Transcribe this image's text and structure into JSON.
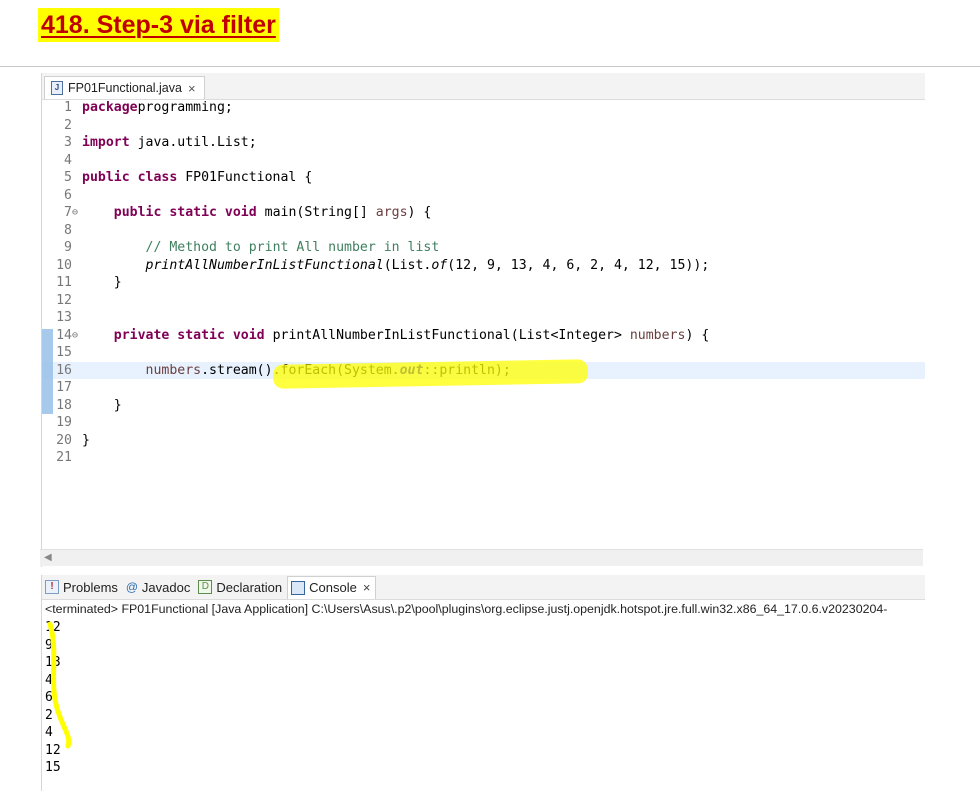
{
  "page_title": "418. Step-3 via filter",
  "editor": {
    "tab_label": "FP01Functional.java",
    "tab_close": "×",
    "lines": [
      {
        "n": "1",
        "tokens": [
          [
            "kw",
            "package"
          ],
          [
            "",
            "programming;"
          ]
        ]
      },
      {
        "n": "2",
        "tokens": []
      },
      {
        "n": "3",
        "tokens": [
          [
            "kw",
            "import"
          ],
          [
            "",
            " java.util.List;"
          ]
        ]
      },
      {
        "n": "4",
        "tokens": []
      },
      {
        "n": "5",
        "tokens": [
          [
            "kw",
            "public class"
          ],
          [
            "",
            " FP01Functional {"
          ]
        ]
      },
      {
        "n": "6",
        "tokens": []
      },
      {
        "n": "7",
        "fold": "⊖",
        "tokens": [
          [
            "",
            "    "
          ],
          [
            "kw",
            "public static void"
          ],
          [
            "",
            " main(String[] "
          ],
          [
            "pr",
            "args"
          ],
          [
            "",
            ") {"
          ]
        ]
      },
      {
        "n": "8",
        "tokens": []
      },
      {
        "n": "9",
        "tokens": [
          [
            "",
            "        "
          ],
          [
            "cm",
            "// Method to print All number in list"
          ]
        ]
      },
      {
        "n": "10",
        "tokens": [
          [
            "",
            "        "
          ],
          [
            "it",
            "printAllNumberInListFunctional"
          ],
          [
            "",
            "(List."
          ],
          [
            "it",
            "of"
          ],
          [
            "",
            "(12, 9, 13, 4, 6, 2, 4, 12, 15));"
          ]
        ]
      },
      {
        "n": "11",
        "tokens": [
          [
            "",
            "    }"
          ]
        ]
      },
      {
        "n": "12",
        "tokens": []
      },
      {
        "n": "13",
        "tokens": []
      },
      {
        "n": "14",
        "fold": "⊖",
        "tokens": [
          [
            "",
            "    "
          ],
          [
            "kw",
            "private static void"
          ],
          [
            "",
            " printAllNumberInListFunctional(List<Integer> "
          ],
          [
            "pr",
            "numbers"
          ],
          [
            "",
            ") {"
          ]
        ]
      },
      {
        "n": "15",
        "tokens": []
      },
      {
        "n": "16",
        "current": true,
        "tokens": [
          [
            "",
            "        "
          ],
          [
            "pr",
            "numbers"
          ],
          [
            "",
            ".stream().forEach(System."
          ],
          [
            "fld",
            "out"
          ],
          [
            "",
            "::println);"
          ]
        ]
      },
      {
        "n": "17",
        "tokens": []
      },
      {
        "n": "18",
        "tokens": [
          [
            "",
            "    }"
          ]
        ]
      },
      {
        "n": "19",
        "tokens": []
      },
      {
        "n": "20",
        "tokens": [
          [
            "",
            "}"
          ]
        ]
      },
      {
        "n": "21",
        "tokens": []
      }
    ]
  },
  "console": {
    "tabs": [
      {
        "label": "Problems",
        "icon": "problems-icon"
      },
      {
        "label": "Javadoc",
        "icon": "javadoc-icon"
      },
      {
        "label": "Declaration",
        "icon": "declaration-icon"
      },
      {
        "label": "Console",
        "icon": "console-icon",
        "active": true
      }
    ],
    "tab_close": "×",
    "status": "<terminated> FP01Functional [Java Application] C:\\Users\\Asus\\.p2\\pool\\plugins\\org.eclipse.justj.openjdk.hotspot.jre.full.win32.x86_64_17.0.6.v20230204-",
    "output": [
      "12",
      "9",
      "13",
      "4",
      "6",
      "2",
      "4",
      "12",
      "15"
    ]
  },
  "colors": {
    "title_bg": "#ffff00",
    "title_text": "#c00000",
    "keyword": "#7f0055",
    "comment": "#3f7f5f",
    "field": "#0000c0",
    "current_line": "#e8f2fe",
    "annotation": "#ffff00"
  }
}
